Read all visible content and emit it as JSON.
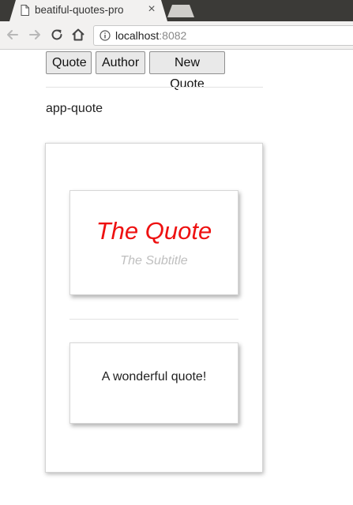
{
  "browser": {
    "tab_title": "beatiful-quotes-pro",
    "tab_close": "×",
    "url_host": "localhost",
    "url_port": ":8082"
  },
  "toolbar_icons": [
    "back-arrow-icon",
    "forward-arrow-icon",
    "reload-icon",
    "home-icon",
    "info-icon"
  ],
  "app": {
    "buttons": {
      "quote": "Quote",
      "author": "Author",
      "new_quote": "New Quote"
    },
    "component_label": "app-quote",
    "quote": {
      "title": "The Quote",
      "subtitle": "The Subtitle",
      "text": "A wonderful quote!"
    }
  },
  "colors": {
    "title": "#ee1111",
    "subtitle": "#bfbfbf",
    "chrome_dark": "#3b3a37",
    "chrome_light": "#f2f1f0"
  }
}
